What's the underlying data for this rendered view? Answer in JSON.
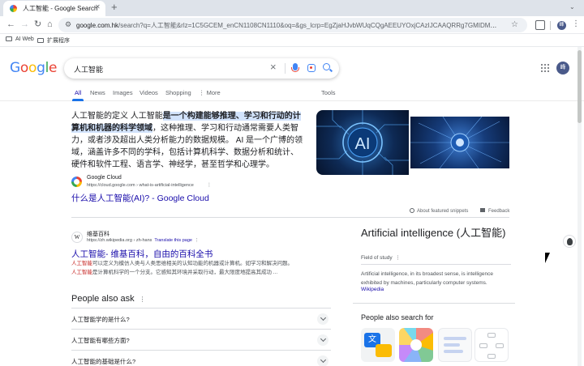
{
  "browser": {
    "tab_title": "人工智能 - Google Search",
    "tab_close": "✕",
    "new_tab": "+",
    "tab_menu": "⌄",
    "back": "←",
    "forward": "→",
    "reload": "↻",
    "home": "⌂",
    "url_host": "google.com.hk",
    "url_rest": "/search?q=人工智能&rlz=1C5GCEM_enCN1108CN1110&oq=&gs_lcrp=EgZjaHJvbWUqCQgAEEUYOxjCAzIJCAAQRRg7GMIDMgkIARBFGDsYwgMyCQgC...",
    "profile_initial": "峰",
    "kebab": "⋮",
    "bookmarks": [
      "AI Web",
      "扩展程序"
    ]
  },
  "search": {
    "logo": [
      "G",
      "o",
      "o",
      "g",
      "l",
      "e"
    ],
    "query": "人工智能",
    "clear": "×",
    "account_initial": "峰"
  },
  "tabs": {
    "items": [
      "All",
      "News",
      "Images",
      "Videos",
      "Shopping",
      "⋮ More"
    ],
    "tools": "Tools"
  },
  "featured_snippet": {
    "text_pre": "人工智能的定义 人工智能",
    "text_highlight": "是一个构建能够推理、学习和行动的计算机和机器的科学领域",
    "text_post": "，这种推理、学习和行动通常需要人类智力，或者涉及超出人类分析能力的数据规模。 AI 是一个广博的领域，涵盖许多不同的学科，包括计算机科学、数据分析和统计、硬件和软件工程、语言学、神经学，甚至哲学和心理学。",
    "source_name": "Google Cloud",
    "source_url": "https://cloud.google.com › what-is-artificial-intelligence",
    "menu": "⋮",
    "link": "什么是人工智能(AI)?   - Google Cloud",
    "image1_text": "AI",
    "about": "About featured snippets",
    "feedback": "Feedback"
  },
  "wiki_result": {
    "favicon": "W",
    "site": "维基百科",
    "url": "https://zh.wikipedia.org › zh-hans",
    "translate": "Translate this page",
    "menu": "⋮",
    "title": "人工智能- 维基百科，自由的百科全书",
    "line1_em": "人工智能",
    "line1": "可以定义为模仿人类与人类思维相关的认知功能的机器或计算机。如学习和解决问题。",
    "line2_em": "人工智能",
    "line2": "是计算机科学的一个分支。它感知其环境并采取行动，最大限度地提高其成功 ..."
  },
  "people_also_ask": {
    "title": "People also ask",
    "menu": "⋮",
    "questions": [
      "人工智能学的是什么?",
      "人工智能有哪些方面?",
      "人工智能的基础是什么?"
    ]
  },
  "knowledge_panel": {
    "title": "Artificial intelligence (人工智能)",
    "subtitle": "Field of study",
    "menu": "⋮",
    "description": "Artificial intelligence, in its broadest sense, is intelligence exhibited by machines, particularly computer systems.",
    "link": "Wikipedia",
    "pasf_title": "People also search for",
    "pasf1_glyph": "文"
  }
}
